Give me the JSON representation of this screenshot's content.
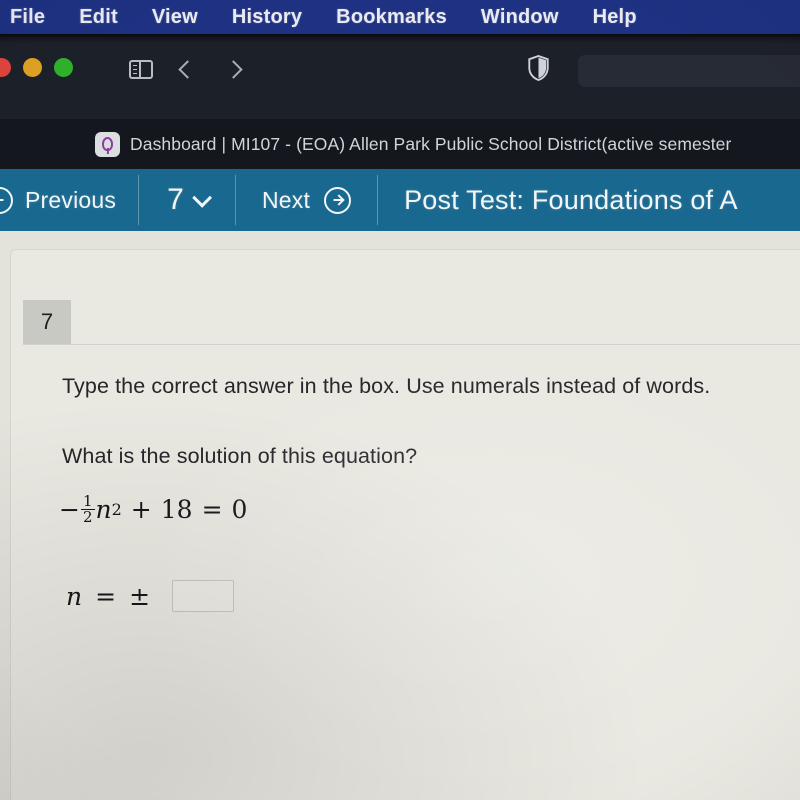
{
  "menubar": {
    "items": [
      {
        "label": "File"
      },
      {
        "label": "Edit"
      },
      {
        "label": "View"
      },
      {
        "label": "History"
      },
      {
        "label": "Bookmarks"
      },
      {
        "label": "Window"
      },
      {
        "label": "Help"
      }
    ],
    "background_color": "#1e3182",
    "text_color": "#e9eaf2"
  },
  "browser": {
    "traffic_lights": [
      {
        "name": "close",
        "color": "#e0443e"
      },
      {
        "name": "minimize",
        "color": "#dea123"
      },
      {
        "name": "zoom",
        "color": "#2fb12a"
      }
    ],
    "icons": {
      "sidebar": "sidebar-icon",
      "back": "chevron-left-icon",
      "forward": "chevron-right-icon",
      "privacy": "shield-icon"
    },
    "address_bar_value": "",
    "address_bar_placeholder": "",
    "tab": {
      "favicon": "lightbulb-icon",
      "title": "Dashboard | MI107 - (EOA) Allen Park Public School District(active semester"
    },
    "chrome_color": "#1c2029",
    "tabstrip_color": "#14171e"
  },
  "app_toolbar": {
    "previous_label": "Previous",
    "previous_icon": "circle-arrow-left-icon",
    "question_number": "7",
    "question_dropdown_icon": "chevron-down-icon",
    "next_label": "Next",
    "next_icon": "circle-arrow-right-icon",
    "assessment_title": "Post Test: Foundations of A",
    "background_color": "#19688f",
    "text_color": "#f2f6f8"
  },
  "question": {
    "number": "7",
    "instructions": "Type the correct answer in the box. Use numerals instead of words.",
    "prompt": "What is the solution of this equation?",
    "equation": {
      "minus": "−",
      "fraction_numerator": "1",
      "fraction_denominator": "2",
      "variable": "n",
      "exponent": "2",
      "plus": "+",
      "constant": "18",
      "equals": "=",
      "right_side": "0",
      "plain_text": "−(1/2)n² + 18 = 0"
    },
    "answer": {
      "variable": "n",
      "equals": "=",
      "plus_minus": "±",
      "input_value": "",
      "input_placeholder": ""
    },
    "page_background": "#e9e8e1"
  }
}
